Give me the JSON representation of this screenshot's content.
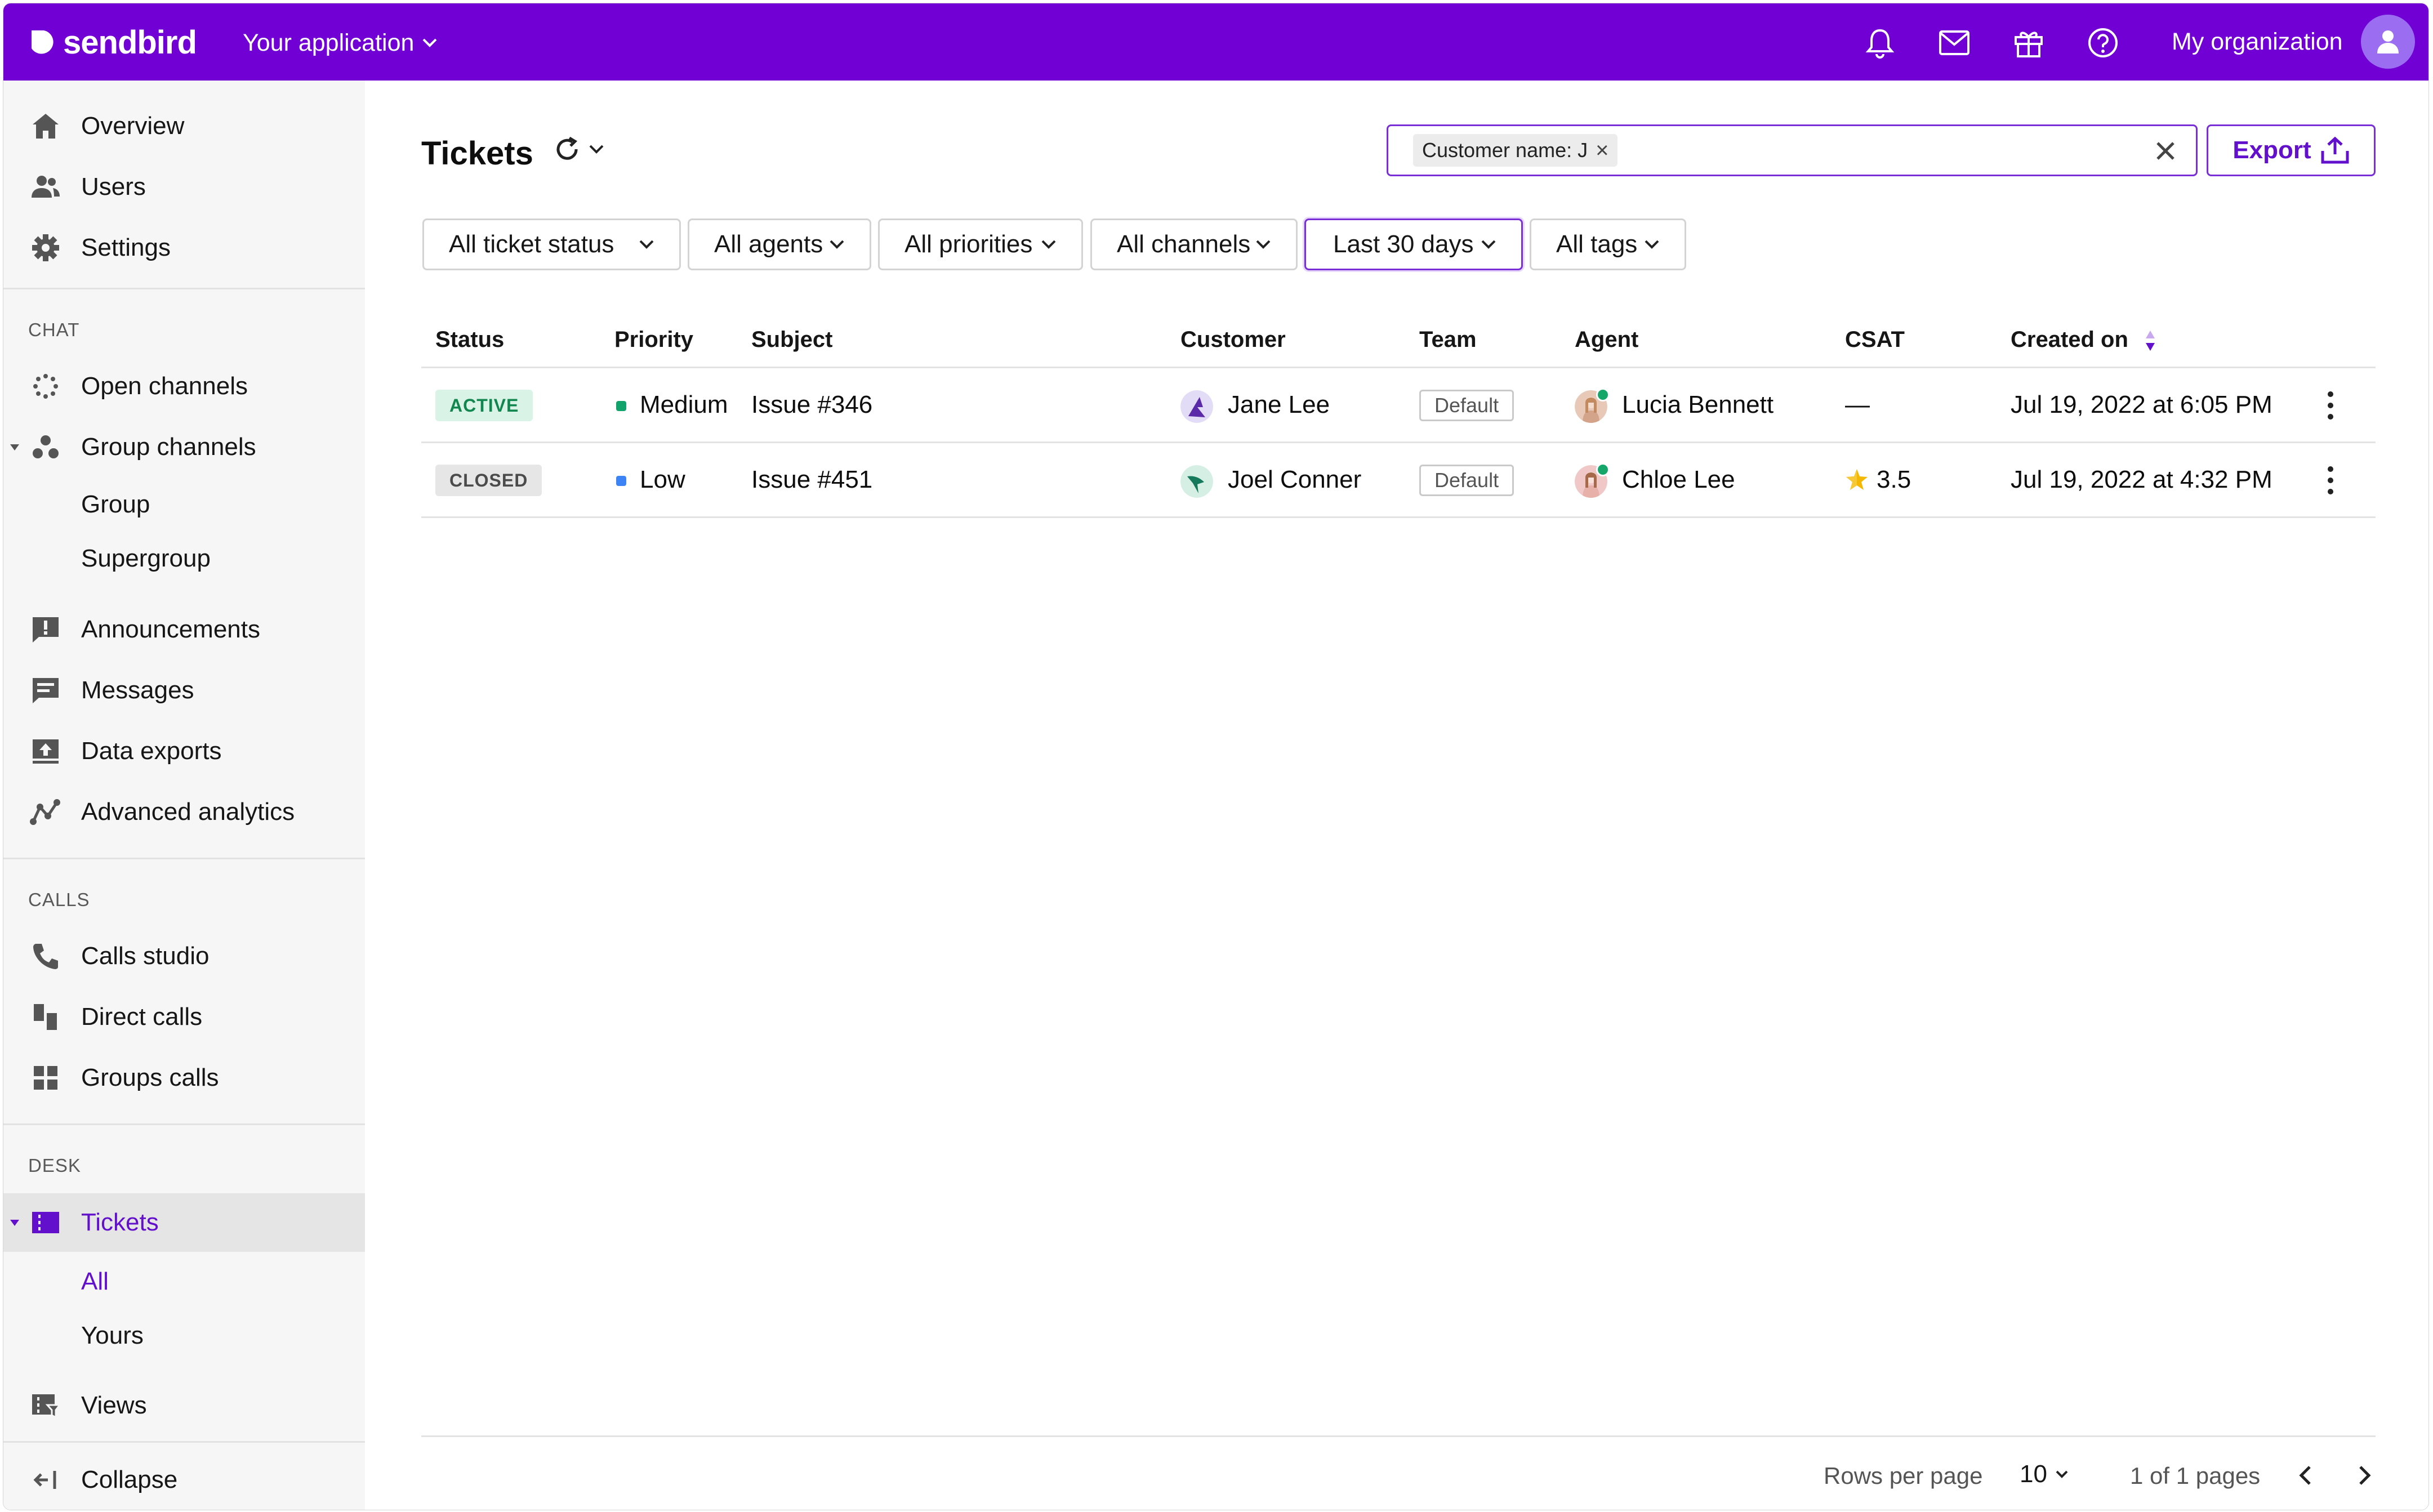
{
  "brand": {
    "name": "sendbird",
    "accent": "#7000d4",
    "accent_text": "#6210cc"
  },
  "header": {
    "app_select": "Your application",
    "icons": [
      "bell-icon",
      "mail-icon",
      "gift-icon",
      "help-icon"
    ],
    "org_label": "My organization"
  },
  "sidebar": {
    "top": [
      {
        "label": "Overview",
        "icon": "home-icon"
      },
      {
        "label": "Users",
        "icon": "users-icon"
      },
      {
        "label": "Settings",
        "icon": "gear-icon"
      }
    ],
    "chat_section": "CHAT",
    "chat": [
      {
        "label": "Open channels",
        "icon": "open-channels-icon"
      },
      {
        "label": "Group channels",
        "icon": "group-channels-icon"
      },
      {
        "label": "Group"
      },
      {
        "label": "Supergroup"
      },
      {
        "label": "Announcements",
        "icon": "announcements-icon"
      },
      {
        "label": "Messages",
        "icon": "messages-icon"
      },
      {
        "label": "Data exports",
        "icon": "data-exports-icon"
      },
      {
        "label": "Advanced analytics",
        "icon": "analytics-icon"
      }
    ],
    "calls_section": "CALLS",
    "calls": [
      {
        "label": "Calls studio",
        "icon": "phone-icon"
      },
      {
        "label": "Direct calls",
        "icon": "direct-calls-icon"
      },
      {
        "label": "Groups calls",
        "icon": "groups-calls-icon"
      }
    ],
    "desk_section": "DESK",
    "desk": [
      {
        "label": "Tickets",
        "icon": "tickets-icon"
      },
      {
        "label": "All"
      },
      {
        "label": "Yours"
      },
      {
        "label": "Views",
        "icon": "views-icon"
      }
    ],
    "collapse": "Collapse"
  },
  "main": {
    "title": "Tickets",
    "search_chip": "Customer name: J",
    "export_label": "Export",
    "filters": [
      "All ticket status",
      "All agents",
      "All priorities",
      "All channels",
      "Last 30 days",
      "All tags"
    ],
    "columns": [
      "Status",
      "Priority",
      "Subject",
      "Customer",
      "Team",
      "Agent",
      "CSAT",
      "Created on"
    ],
    "rows": [
      {
        "status": "ACTIVE",
        "priority": "Medium",
        "priority_color": "#11a36b",
        "subject": "Issue #346",
        "customer": "Jane Lee",
        "team": "Default",
        "agent": "Lucia Bennett",
        "csat": "—",
        "created": "Jul 19, 2022 at 6:05 PM"
      },
      {
        "status": "CLOSED",
        "priority": "Low",
        "priority_color": "#3c83f6",
        "subject": "Issue #451",
        "customer": "Joel Conner",
        "team": "Default",
        "agent": "Chloe Lee",
        "csat": "3.5",
        "created": "Jul 19, 2022 at 4:32 PM"
      }
    ],
    "footer": {
      "rows_per_page_label": "Rows per page",
      "rows_per_page": "10",
      "pages": "1 of 1 pages"
    }
  }
}
